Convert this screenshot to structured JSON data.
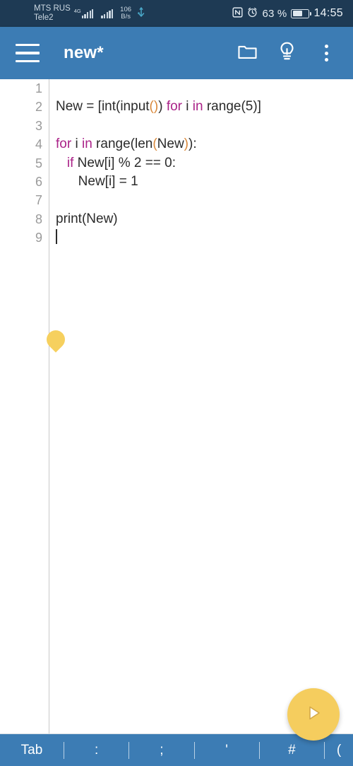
{
  "status_bar": {
    "carrier_line1": "MTS RUS",
    "carrier_line2": "Tele2",
    "network_tag": "4G",
    "data_rate_value": "106",
    "data_rate_unit": "B/s",
    "usb_icon": "usb-icon",
    "nfc_icon": "nfc-icon",
    "alarm_icon": "alarm-clock-icon",
    "battery_percent": "63 %",
    "battery_icon": "battery-icon",
    "time": "14:55"
  },
  "app_bar": {
    "menu_icon": "hamburger-menu-icon",
    "title": "new*",
    "folder_icon": "folder-icon",
    "lightbulb_icon": "lightbulb-icon",
    "overflow_icon": "overflow-menu-icon"
  },
  "editor": {
    "gutter_numbers": [
      "1",
      "2",
      "3",
      "4",
      "5",
      "6",
      "7",
      "8",
      "9"
    ],
    "lines": [
      {
        "n": "1",
        "tokens": []
      },
      {
        "n": "2",
        "tokens": [
          {
            "t": "New = [int(input",
            "c": "plain"
          },
          {
            "t": "()",
            "c": "bracket"
          },
          {
            "t": ") ",
            "c": "plain"
          },
          {
            "t": "for",
            "c": "keyword"
          },
          {
            "t": " i ",
            "c": "plain"
          },
          {
            "t": "in",
            "c": "keyword"
          },
          {
            "t": " range(5)]",
            "c": "plain"
          }
        ]
      },
      {
        "n": "3",
        "tokens": []
      },
      {
        "n": "4",
        "tokens": [
          {
            "t": "for",
            "c": "keyword"
          },
          {
            "t": " i ",
            "c": "plain"
          },
          {
            "t": "in",
            "c": "keyword"
          },
          {
            "t": " range(len",
            "c": "plain"
          },
          {
            "t": "(",
            "c": "bracket"
          },
          {
            "t": "New",
            "c": "plain"
          },
          {
            "t": ")",
            "c": "bracket"
          },
          {
            "t": "):",
            "c": "plain"
          }
        ]
      },
      {
        "n": "5",
        "tokens": [
          {
            "t": "   ",
            "c": "plain"
          },
          {
            "t": "if",
            "c": "keyword"
          },
          {
            "t": " New[i] % 2 == 0:",
            "c": "plain"
          }
        ]
      },
      {
        "n": "6",
        "tokens": [
          {
            "t": "      New[i] = 1",
            "c": "plain"
          }
        ]
      },
      {
        "n": "7",
        "tokens": []
      },
      {
        "n": "8",
        "tokens": [
          {
            "t": "print(New)",
            "c": "plain"
          }
        ]
      },
      {
        "n": "9",
        "tokens": [],
        "caret": true
      }
    ],
    "plain_text": "\nNew = [int(input()) for i in range(5)]\n\nfor i in range(len(New)):\n   if New[i] % 2 == 0:\n      New[i] = 1\n\nprint(New)\n",
    "cursor_handle": "text-cursor-handle"
  },
  "run_button": {
    "icon": "play-icon",
    "label": "Run"
  },
  "bottom_toolbar": {
    "keys": [
      "Tab",
      ":",
      ";",
      "'",
      "#",
      "("
    ]
  },
  "colors": {
    "status_bar": "#1e3a54",
    "app_bar": "#3c7cb4",
    "accent_yellow": "#f5cd5e",
    "keyword": "#aa2288",
    "bracket": "#d9883a",
    "code_text": "#2b2b2b",
    "gutter_text": "#9a9a9a",
    "editor_bg": "#ffffff"
  }
}
